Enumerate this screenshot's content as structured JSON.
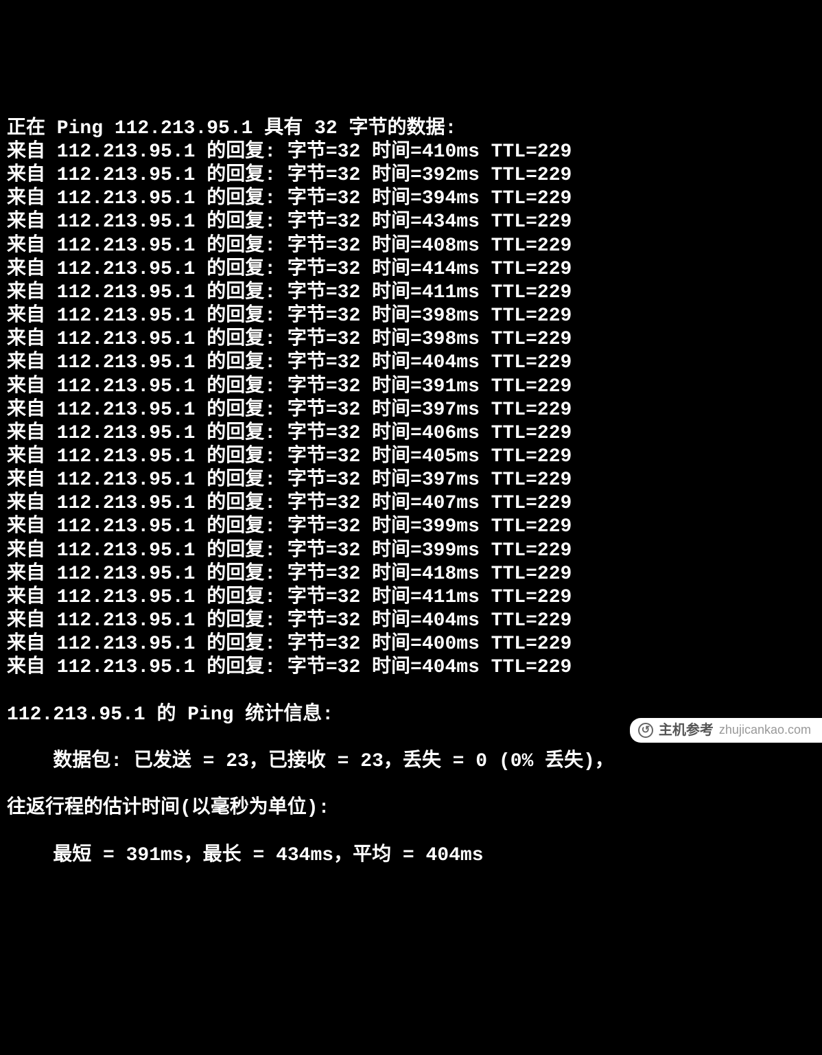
{
  "ping": {
    "header_prefix": "正在 Ping ",
    "target": "112.213.95.1",
    "header_suffix": " 具有 32 字节的数据:",
    "reply_prefix": "来自 ",
    "reply_mid": " 的回复: 字节=",
    "bytes": "32",
    "time_label": " 时间=",
    "ttl_label": " TTL=",
    "ttl": "229",
    "replies": [
      {
        "time": "410ms"
      },
      {
        "time": "392ms"
      },
      {
        "time": "394ms"
      },
      {
        "time": "434ms"
      },
      {
        "time": "408ms"
      },
      {
        "time": "414ms"
      },
      {
        "time": "411ms"
      },
      {
        "time": "398ms"
      },
      {
        "time": "398ms"
      },
      {
        "time": "404ms"
      },
      {
        "time": "391ms"
      },
      {
        "time": "397ms"
      },
      {
        "time": "406ms"
      },
      {
        "time": "405ms"
      },
      {
        "time": "397ms"
      },
      {
        "time": "407ms"
      },
      {
        "time": "399ms"
      },
      {
        "time": "399ms"
      },
      {
        "time": "418ms"
      },
      {
        "time": "411ms"
      },
      {
        "time": "404ms"
      },
      {
        "time": "400ms"
      },
      {
        "time": "404ms"
      }
    ],
    "stats_header_prefix": "",
    "stats_header_mid": " 的 Ping 统计信息:",
    "packets_line_prefix": "    数据包: 已发送 = ",
    "sent": "23",
    "packets_recv_prefix": "，已接收 = ",
    "received": "23",
    "packets_lost_prefix": "，丢失 = ",
    "lost": "0",
    "packets_loss_pct_prefix": " (",
    "loss_pct": "0%",
    "packets_loss_suffix": " 丢失)，",
    "rtt_label": "往返行程的估计时间(以毫秒为单位):",
    "rtt_min_prefix": "    最短 = ",
    "min": "391ms",
    "rtt_max_prefix": "，最长 = ",
    "max": "434ms",
    "rtt_avg_prefix": "，平均 = ",
    "avg": "404ms"
  },
  "watermark": {
    "text": "主机参考",
    "host": "zhujicankao.com"
  }
}
